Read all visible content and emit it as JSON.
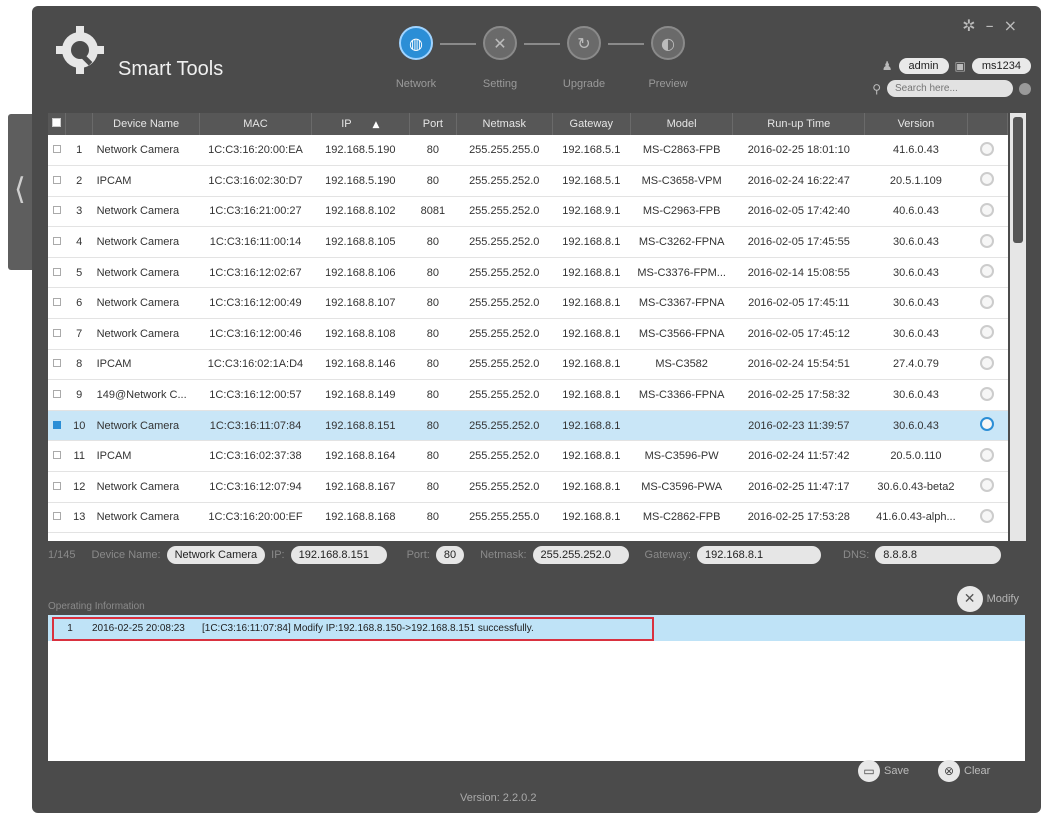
{
  "app": {
    "title": "Smart Tools",
    "version_text": "Version: 2.2.0.2"
  },
  "steps": [
    {
      "label": "Network",
      "icon": "globe-icon",
      "active": true
    },
    {
      "label": "Setting",
      "icon": "wrench-icon",
      "active": false
    },
    {
      "label": "Upgrade",
      "icon": "refresh-icon",
      "active": false
    },
    {
      "label": "Preview",
      "icon": "compass-icon",
      "active": false
    }
  ],
  "user": {
    "name": "admin",
    "password": "ms1234"
  },
  "search": {
    "placeholder": "Search here..."
  },
  "table": {
    "headers": [
      "Device Name",
      "MAC",
      "IP",
      "Port",
      "Netmask",
      "Gateway",
      "Model",
      "Run-up Time",
      "Version"
    ],
    "sort_column": "IP",
    "rows": [
      {
        "n": "1",
        "name": "Network Camera",
        "mac": "1C:C3:16:20:00:EA",
        "ip": "192.168.5.190",
        "port": "80",
        "netmask": "255.255.255.0",
        "gateway": "192.168.5.1",
        "model": "MS-C2863-FPB",
        "runup": "2016-02-25 18:01:10",
        "version": "41.6.0.43",
        "selected": false
      },
      {
        "n": "2",
        "name": "IPCAM",
        "mac": "1C:C3:16:02:30:D7",
        "ip": "192.168.5.190",
        "port": "80",
        "netmask": "255.255.252.0",
        "gateway": "192.168.5.1",
        "model": "MS-C3658-VPM",
        "runup": "2016-02-24 16:22:47",
        "version": "20.5.1.109",
        "selected": false
      },
      {
        "n": "3",
        "name": "Network Camera",
        "mac": "1C:C3:16:21:00:27",
        "ip": "192.168.8.102",
        "port": "8081",
        "netmask": "255.255.252.0",
        "gateway": "192.168.9.1",
        "model": "MS-C2963-FPB",
        "runup": "2016-02-05 17:42:40",
        "version": "40.6.0.43",
        "selected": false
      },
      {
        "n": "4",
        "name": "Network Camera",
        "mac": "1C:C3:16:11:00:14",
        "ip": "192.168.8.105",
        "port": "80",
        "netmask": "255.255.252.0",
        "gateway": "192.168.8.1",
        "model": "MS-C3262-FPNA",
        "runup": "2016-02-05 17:45:55",
        "version": "30.6.0.43",
        "selected": false
      },
      {
        "n": "5",
        "name": "Network Camera",
        "mac": "1C:C3:16:12:02:67",
        "ip": "192.168.8.106",
        "port": "80",
        "netmask": "255.255.252.0",
        "gateway": "192.168.8.1",
        "model": "MS-C3376-FPM...",
        "runup": "2016-02-14 15:08:55",
        "version": "30.6.0.43",
        "selected": false
      },
      {
        "n": "6",
        "name": "Network Camera",
        "mac": "1C:C3:16:12:00:49",
        "ip": "192.168.8.107",
        "port": "80",
        "netmask": "255.255.252.0",
        "gateway": "192.168.8.1",
        "model": "MS-C3367-FPNA",
        "runup": "2016-02-05 17:45:11",
        "version": "30.6.0.43",
        "selected": false
      },
      {
        "n": "7",
        "name": "Network Camera",
        "mac": "1C:C3:16:12:00:46",
        "ip": "192.168.8.108",
        "port": "80",
        "netmask": "255.255.252.0",
        "gateway": "192.168.8.1",
        "model": "MS-C3566-FPNA",
        "runup": "2016-02-05 17:45:12",
        "version": "30.6.0.43",
        "selected": false
      },
      {
        "n": "8",
        "name": "IPCAM",
        "mac": "1C:C3:16:02:1A:D4",
        "ip": "192.168.8.146",
        "port": "80",
        "netmask": "255.255.252.0",
        "gateway": "192.168.8.1",
        "model": "MS-C3582",
        "runup": "2016-02-24 15:54:51",
        "version": "27.4.0.79",
        "selected": false
      },
      {
        "n": "9",
        "name": "149@Network C...",
        "mac": "1C:C3:16:12:00:57",
        "ip": "192.168.8.149",
        "port": "80",
        "netmask": "255.255.252.0",
        "gateway": "192.168.8.1",
        "model": "MS-C3366-FPNA",
        "runup": "2016-02-25 17:58:32",
        "version": "30.6.0.43",
        "selected": false
      },
      {
        "n": "10",
        "name": "Network Camera",
        "mac": "1C:C3:16:11:07:84",
        "ip": "192.168.8.151",
        "port": "80",
        "netmask": "255.255.252.0",
        "gateway": "192.168.8.1",
        "model": "",
        "runup": "2016-02-23 11:39:57",
        "version": "30.6.0.43",
        "selected": true
      },
      {
        "n": "11",
        "name": "IPCAM",
        "mac": "1C:C3:16:02:37:38",
        "ip": "192.168.8.164",
        "port": "80",
        "netmask": "255.255.252.0",
        "gateway": "192.168.8.1",
        "model": "MS-C3596-PW",
        "runup": "2016-02-24 11:57:42",
        "version": "20.5.0.110",
        "selected": false
      },
      {
        "n": "12",
        "name": "Network Camera",
        "mac": "1C:C3:16:12:07:94",
        "ip": "192.168.8.167",
        "port": "80",
        "netmask": "255.255.252.0",
        "gateway": "192.168.8.1",
        "model": "MS-C3596-PWA",
        "runup": "2016-02-25 11:47:17",
        "version": "30.6.0.43-beta2",
        "selected": false
      },
      {
        "n": "13",
        "name": "Network Camera",
        "mac": "1C:C3:16:20:00:EF",
        "ip": "192.168.8.168",
        "port": "80",
        "netmask": "255.255.255.0",
        "gateway": "192.168.8.1",
        "model": "MS-C2862-FPB",
        "runup": "2016-02-25 17:53:28",
        "version": "41.6.0.43-alph...",
        "selected": false
      }
    ]
  },
  "info": {
    "count": "1/145",
    "device_name_label": "Device Name:",
    "device_name": "Network Camera",
    "ip_label": "IP:",
    "ip": "192.168.8.151",
    "port_label": "Port:",
    "port": "80",
    "netmask_label": "Netmask:",
    "netmask": "255.255.252.0",
    "gateway_label": "Gateway:",
    "gateway": "192.168.8.1",
    "dns_label": "DNS:",
    "dns": "8.8.8.8"
  },
  "modify_label": "Modify",
  "operating": {
    "label": "Operating Information",
    "rows": [
      {
        "n": "1",
        "time": "2016-02-25 20:08:23",
        "message": "[1C:C3:16:11:07:84] Modify IP:192.168.8.150->192.168.8.151 successfully."
      }
    ]
  },
  "footer": {
    "save_label": "Save",
    "clear_label": "Clear"
  },
  "colors": {
    "accent": "#2b8ed6",
    "selected_row": "#c9e6f7",
    "highlight_border": "#d9313f",
    "window_bg": "#4b4b4b"
  }
}
